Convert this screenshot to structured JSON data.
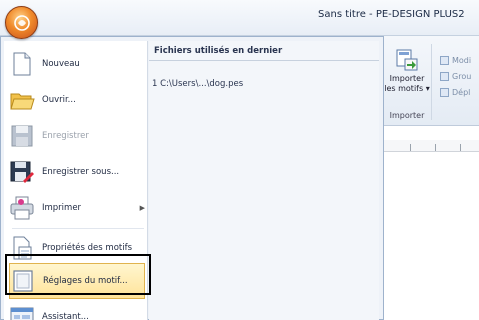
{
  "window": {
    "title": "Sans titre - PE-DESIGN PLUS2"
  },
  "app_menu": {
    "items": [
      {
        "label": "Nouveau",
        "icon": "new-document-icon",
        "enabled": true
      },
      {
        "label": "Ouvrir...",
        "icon": "open-folder-icon",
        "enabled": true
      },
      {
        "label": "Enregistrer",
        "icon": "save-icon",
        "enabled": false
      },
      {
        "label": "Enregistrer sous...",
        "icon": "save-as-icon",
        "enabled": true
      },
      {
        "label": "Imprimer",
        "icon": "print-icon",
        "enabled": true,
        "has_submenu": true
      },
      {
        "label": "Propriétés des motifs",
        "icon": "properties-icon",
        "enabled": true
      },
      {
        "label": "Réglages du motif...",
        "icon": "design-settings-icon",
        "enabled": true,
        "highlighted": true
      },
      {
        "label": "Assistant...",
        "icon": "wizard-icon",
        "enabled": true
      }
    ],
    "recent": {
      "header": "Fichiers utilisés en dernier",
      "files": [
        "1 C:\\Users\\...\\dog.pes"
      ]
    }
  },
  "ribbon": {
    "import_button": {
      "label_line1": "Importer",
      "label_line2": "les motifs",
      "arrow": "▾"
    },
    "group_label": "Importer",
    "small_commands": [
      "Modi",
      "Grou",
      "Dépl"
    ]
  },
  "colors": {
    "highlight_fill": "#ffe39a",
    "highlight_border": "#e0b34e",
    "callout_border": "#000000",
    "disabled_text": "#9aa1ab"
  }
}
